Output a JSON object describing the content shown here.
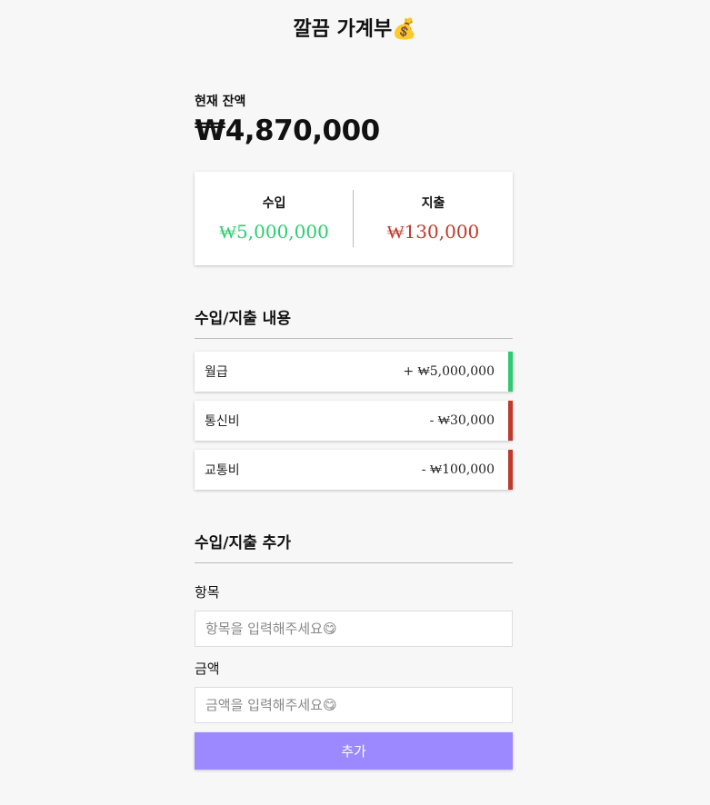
{
  "app": {
    "title": "깔끔 가계부💰"
  },
  "balance": {
    "label": "현재 잔액",
    "value": "₩4,870,000"
  },
  "summary": {
    "income_label": "수입",
    "income_value": "₩5,000,000",
    "expense_label": "지출",
    "expense_value": "₩130,000"
  },
  "history": {
    "title": "수입/지출 내용",
    "items": [
      {
        "name": "월급",
        "amount": "+ ₩5,000,000",
        "type": "income"
      },
      {
        "name": "통신비",
        "amount": "- ₩30,000",
        "type": "expense"
      },
      {
        "name": "교통비",
        "amount": "- ₩100,000",
        "type": "expense"
      }
    ]
  },
  "form": {
    "title": "수입/지출 추가",
    "item_label": "항목",
    "item_placeholder": "항목을 입력해주세요😋",
    "amount_label": "금액",
    "amount_placeholder": "금액을 입력해주세요😋",
    "submit_label": "추가"
  },
  "colors": {
    "income": "#2ecc71",
    "expense": "#c0392b",
    "accent": "#9c88ff"
  }
}
